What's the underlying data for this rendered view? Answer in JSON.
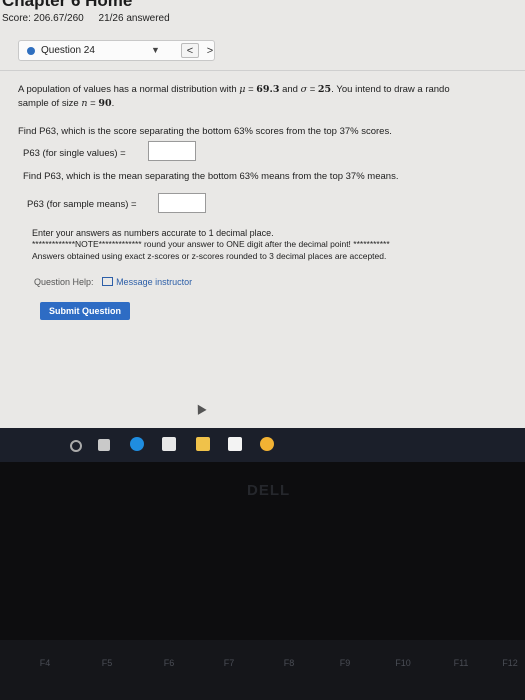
{
  "header": {
    "chapter_title": "Chapter 6 Home",
    "score": "Score: 206.67/260",
    "answered": "21/26 answered"
  },
  "question_nav": {
    "label": "Question 24",
    "prev": "<",
    "next": ">"
  },
  "question": {
    "intro_a": "A population of values has a normal distribution with ",
    "mu_symbol": "μ",
    "eq1": " = ",
    "mu_value": "69.3",
    "and": " and ",
    "sigma_symbol": "σ",
    "eq2": " = ",
    "sigma_value": "25",
    "intro_b": ". You intend to draw a rando",
    "line2_a": "sample of size ",
    "n_symbol": "n",
    "eq3": " = ",
    "n_value": "90",
    "line2_b": ".",
    "part1_prompt": "Find P63, which is the score separating the bottom 63% scores from the top 37% scores.",
    "part1_label": "P63 (for single values) =",
    "part1_value": "",
    "part2_prompt": "Find P63, which is the mean separating the bottom 63% means from the top 37% means.",
    "part2_label": "P63 (for sample means) =",
    "part2_value": ""
  },
  "notes": {
    "line1": "Enter your answers as numbers accurate to 1 decimal place.",
    "line2": "*************NOTE************* round your answer to ONE digit after the decimal point! ***********",
    "line3": "Answers obtained using exact z-scores or z-scores rounded to 3 decimal places are accepted."
  },
  "help": {
    "label": "Question Help:",
    "message": "Message instructor"
  },
  "submit_label": "Submit Question",
  "bezel": {
    "logo": "DELL"
  },
  "keyboard": {
    "fkeys": [
      "F4",
      "F5",
      "F6",
      "F7",
      "F8",
      "F9",
      "F10",
      "F11",
      "F12"
    ]
  },
  "colors": {
    "accent": "#2e6cc4",
    "status_dot": "#2f6fbf",
    "taskbar": "#1b1f2a"
  }
}
